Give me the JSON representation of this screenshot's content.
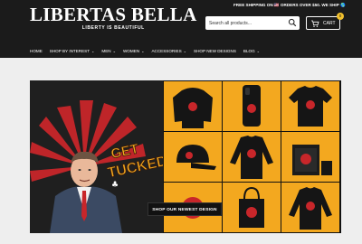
{
  "brand": {
    "name": "LIBERTAS BELLA",
    "tagline": "LIBERTY IS BEAUTIFUL"
  },
  "promo": {
    "text": "FREE SHIPPING ON 🇺🇸 ORDERS OVER $50. WE SHIP 🌎"
  },
  "search": {
    "placeholder": "Search all products...",
    "icon": "search-icon"
  },
  "cart": {
    "label": "CART",
    "count": "0",
    "icon": "cart-icon"
  },
  "nav": {
    "items": [
      {
        "label": "HOME",
        "dropdown": false
      },
      {
        "label": "SHOP BY INTEREST",
        "dropdown": true
      },
      {
        "label": "MEN",
        "dropdown": true
      },
      {
        "label": "WOMEN",
        "dropdown": true
      },
      {
        "label": "ACCESSORIES",
        "dropdown": true
      },
      {
        "label": "SHOP NEW DESIGNS",
        "dropdown": false
      },
      {
        "label": "BLOG",
        "dropdown": true
      }
    ]
  },
  "banner": {
    "headline": "GET TUCKED!",
    "cta_label": "SHOP OUR NEWEST DESIGN",
    "colors": {
      "accent": "#f2a91e",
      "dark": "#111111",
      "red": "#c8262a"
    }
  }
}
